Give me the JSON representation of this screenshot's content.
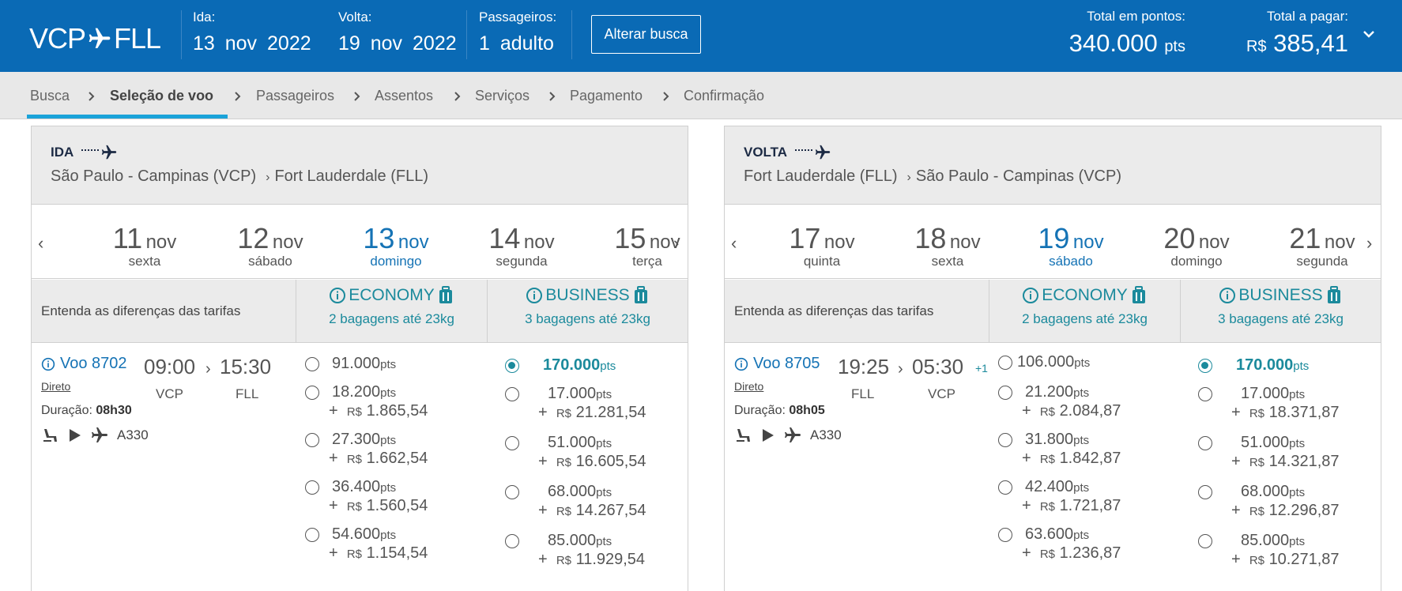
{
  "header": {
    "origin": "VCP",
    "destination": "FLL",
    "ida_label": "Ida:",
    "ida_value": "13 nov 2022",
    "volta_label": "Volta:",
    "volta_value": "19 nov 2022",
    "pass_label": "Passageiros:",
    "pass_value": "1 adulto",
    "alterar_label": "Alterar busca",
    "points_label": "Total em pontos:",
    "points_value": "340.000",
    "points_unit": "pts",
    "pay_label": "Total a pagar:",
    "pay_currency": "R$",
    "pay_value": "385,41"
  },
  "breadcrumb": [
    "Busca",
    "Seleção de voo",
    "Passageiros",
    "Assentos",
    "Serviços",
    "Pagamento",
    "Confirmação"
  ],
  "fare_labels": {
    "entenda": "Entenda as diferenças das tarifas",
    "economy": "ECONOMY",
    "economy_bags": "2 bagagens até 23kg",
    "business": "BUSINESS",
    "business_bags": "3 bagagens até 23kg",
    "pts_unit": "pts",
    "currency": "R$",
    "plus": "+",
    "duration_label": "Duração:"
  },
  "ida": {
    "direction": "IDA",
    "from_city": "São Paulo - Campinas (VCP)",
    "to_city": "Fort Lauderdale (FLL)",
    "dates": [
      {
        "d": "11",
        "m": "nov",
        "w": "sexta"
      },
      {
        "d": "12",
        "m": "nov",
        "w": "sábado"
      },
      {
        "d": "13",
        "m": "nov",
        "w": "domingo"
      },
      {
        "d": "14",
        "m": "nov",
        "w": "segunda"
      },
      {
        "d": "15",
        "m": "nov",
        "w": "terça"
      }
    ],
    "flight": {
      "number": "Voo 8702",
      "direto": "Direto",
      "dep_time": "09:00",
      "arr_time": "15:30",
      "dep_code": "VCP",
      "arr_code": "FLL",
      "plus_day": "",
      "duration": "08h30",
      "aircraft": "A330"
    },
    "economy": [
      {
        "pts": "91.000",
        "cash": ""
      },
      {
        "pts": "18.200",
        "cash": "1.865,54"
      },
      {
        "pts": "27.300",
        "cash": "1.662,54"
      },
      {
        "pts": "36.400",
        "cash": "1.560,54"
      },
      {
        "pts": "54.600",
        "cash": "1.154,54"
      }
    ],
    "business": [
      {
        "pts": "170.000",
        "cash": "",
        "selected": true
      },
      {
        "pts": "17.000",
        "cash": "21.281,54"
      },
      {
        "pts": "51.000",
        "cash": "16.605,54"
      },
      {
        "pts": "68.000",
        "cash": "14.267,54"
      },
      {
        "pts": "85.000",
        "cash": "11.929,54"
      }
    ]
  },
  "volta": {
    "direction": "VOLTA",
    "from_city": "Fort Lauderdale (FLL)",
    "to_city": "São Paulo - Campinas (VCP)",
    "dates": [
      {
        "d": "17",
        "m": "nov",
        "w": "quinta"
      },
      {
        "d": "18",
        "m": "nov",
        "w": "sexta"
      },
      {
        "d": "19",
        "m": "nov",
        "w": "sábado"
      },
      {
        "d": "20",
        "m": "nov",
        "w": "domingo"
      },
      {
        "d": "21",
        "m": "nov",
        "w": "segunda"
      }
    ],
    "flight": {
      "number": "Voo 8705",
      "direto": "Direto",
      "dep_time": "19:25",
      "arr_time": "05:30",
      "dep_code": "FLL",
      "arr_code": "VCP",
      "plus_day": "+1",
      "duration": "08h05",
      "aircraft": "A330"
    },
    "economy": [
      {
        "pts": "106.000",
        "cash": ""
      },
      {
        "pts": "21.200",
        "cash": "2.084,87"
      },
      {
        "pts": "31.800",
        "cash": "1.842,87"
      },
      {
        "pts": "42.400",
        "cash": "1.721,87"
      },
      {
        "pts": "63.600",
        "cash": "1.236,87"
      }
    ],
    "business": [
      {
        "pts": "170.000",
        "cash": "",
        "selected": true
      },
      {
        "pts": "17.000",
        "cash": "18.371,87"
      },
      {
        "pts": "51.000",
        "cash": "14.321,87"
      },
      {
        "pts": "68.000",
        "cash": "12.296,87"
      },
      {
        "pts": "85.000",
        "cash": "10.271,87"
      }
    ]
  },
  "colors": {
    "header_bg": "#0a6ab5",
    "accent_teal": "#1b8a9c",
    "selected_blue": "#1573b5",
    "tab_underline": "#1aa3d9"
  }
}
